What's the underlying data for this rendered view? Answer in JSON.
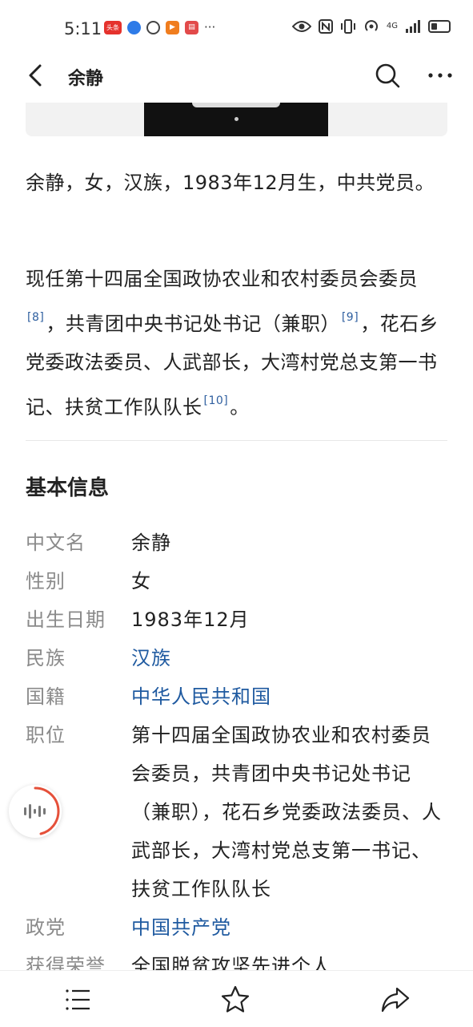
{
  "status_bar": {
    "time": "5:11",
    "notification_icons": [
      {
        "name": "toutiao-app-icon",
        "label": "头条",
        "color": "#e5322d"
      },
      {
        "name": "browser-app-icon",
        "label": "",
        "color": "#2e7be8"
      },
      {
        "name": "camera-app-icon",
        "label": "",
        "color": "#444444"
      },
      {
        "name": "video-app-icon",
        "label": "",
        "color": "#f07d1e"
      },
      {
        "name": "reader-app-icon",
        "label": "",
        "color": "#e24a4a"
      }
    ],
    "overflow": "···",
    "network": "4G",
    "icons": [
      "eye-icon",
      "nfc-icon",
      "vibrate-icon",
      "hotspot-icon",
      "signal-icon",
      "battery-icon"
    ]
  },
  "nav": {
    "title": "余静"
  },
  "paragraphs": {
    "p1": "余静，女，汉族，1983年12月生，中共党员。",
    "p2_a": "现任第十四届全国政协农业和农村委员会委员",
    "p2_ref1": "[8]",
    "p2_b": "，共青团中央书记处书记（兼职）",
    "p2_ref2": "[9]",
    "p2_c": "，花石乡党委政法委员、人武部长，大湾村党总支第一书记、扶贫工作队队长",
    "p2_ref3": "[10]",
    "p2_d": "。"
  },
  "basic_info": {
    "title": "基本信息",
    "rows": [
      {
        "key": "中文名",
        "value": "余静"
      },
      {
        "key": "性别",
        "value": "女"
      },
      {
        "key": "出生日期",
        "value": "1983年12月"
      },
      {
        "key": "民族",
        "value": "汉族"
      },
      {
        "key": "国籍",
        "value": "中华人民共和国"
      },
      {
        "key": "职位",
        "value": "第十四届全国政协农业和农村委员会委员，共青团中央书记处书记（兼职），花石乡党委政法委员、人武部长，大湾村党总支第一书记、扶贫工作队队长"
      },
      {
        "key": "政党",
        "value": "中国共产党"
      },
      {
        "key": "获得荣誉",
        "value": "全国脱贫攻坚先进个人"
      }
    ]
  },
  "colors": {
    "link": "#1f5aa0",
    "label": "#8a8a8a",
    "float_ring": "#e5503a"
  }
}
